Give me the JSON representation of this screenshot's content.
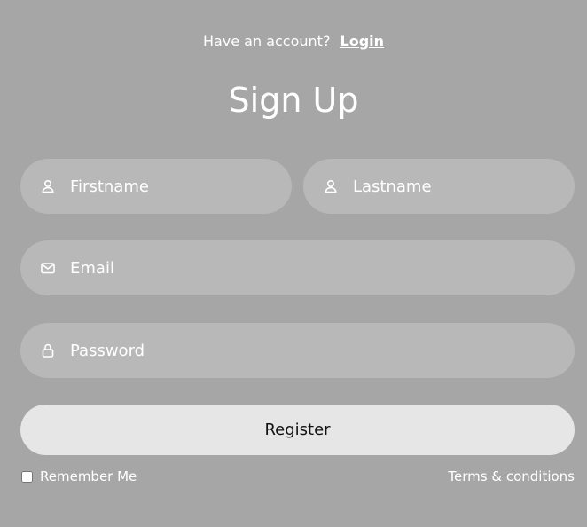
{
  "header": {
    "prompt_text": "Have an account?",
    "login_link": "Login",
    "title": "Sign Up"
  },
  "form": {
    "firstname": {
      "placeholder": "Firstname",
      "value": "",
      "icon": "user-icon"
    },
    "lastname": {
      "placeholder": "Lastname",
      "value": "",
      "icon": "user-icon"
    },
    "email": {
      "placeholder": "Email",
      "value": "",
      "icon": "mail-icon"
    },
    "password": {
      "placeholder": "Password",
      "value": "",
      "icon": "lock-icon"
    },
    "register_label": "Register"
  },
  "footer": {
    "remember_label": "Remember Me",
    "remember_checked": false,
    "terms_label": "Terms & conditions"
  },
  "colors": {
    "background": "#a6a6a6",
    "field_background": "#b8b8b8",
    "button_background": "#e6e6e6",
    "text": "#ffffff"
  }
}
